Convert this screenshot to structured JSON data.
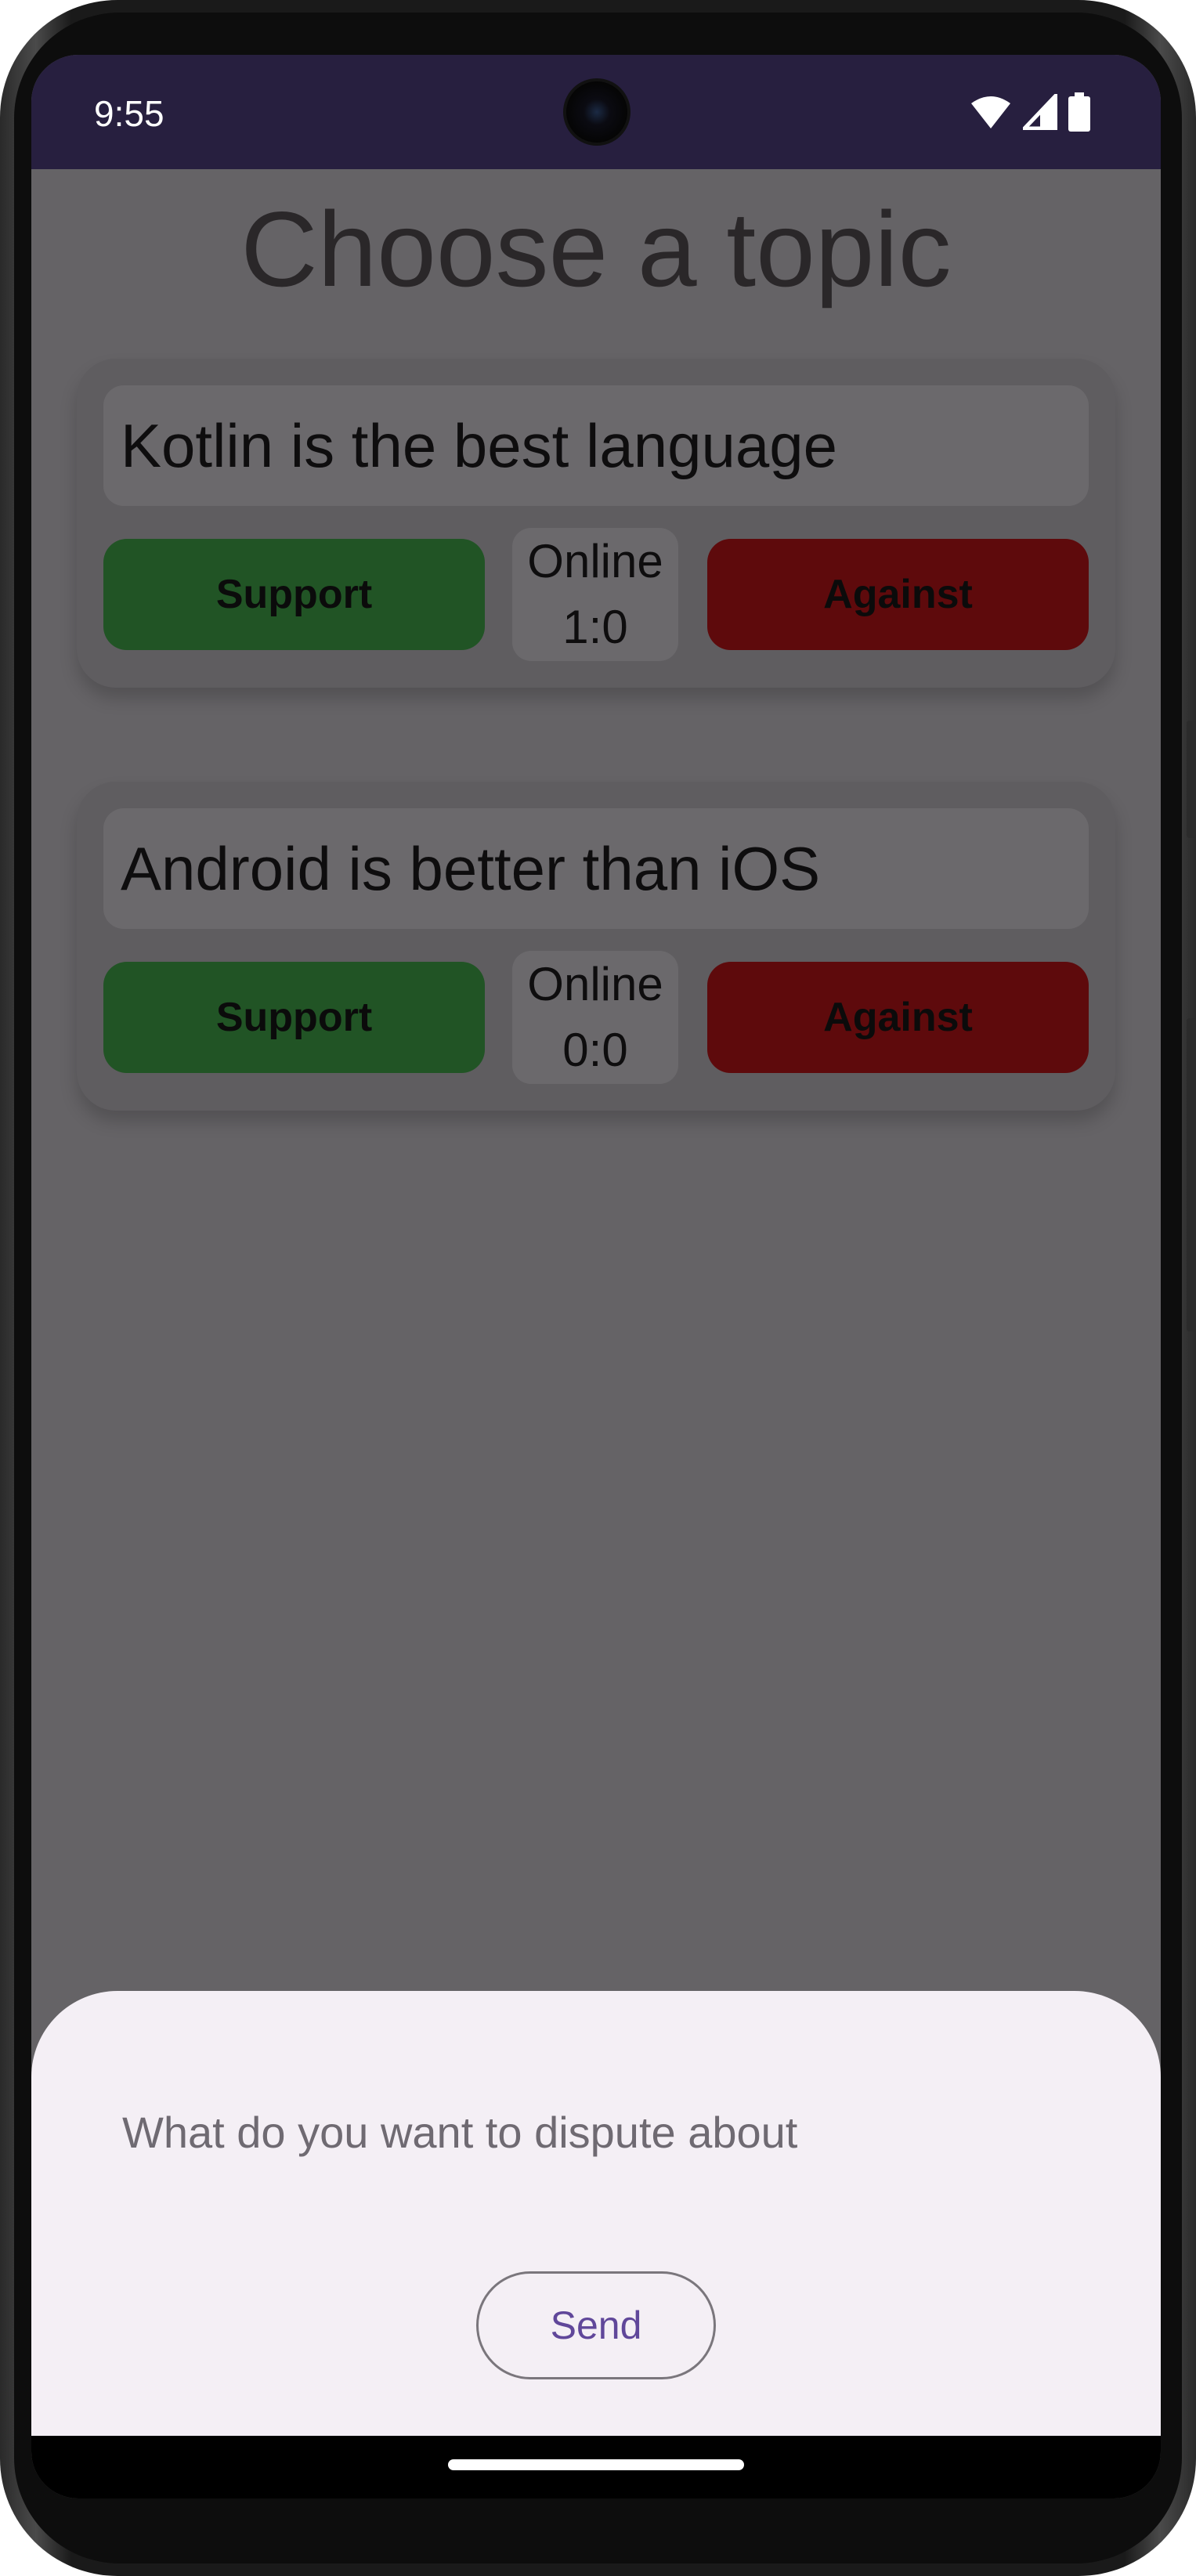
{
  "status_bar": {
    "time": "9:55",
    "icons": [
      "wifi-icon",
      "signal-icon",
      "battery-icon"
    ]
  },
  "page": {
    "title": "Choose a topic"
  },
  "topics": [
    {
      "title": "Kotlin is the best language",
      "support_label": "Support",
      "online_label": "Online",
      "score": "1:0",
      "against_label": "Against"
    },
    {
      "title": "Android is better than iOS",
      "support_label": "Support",
      "online_label": "Online",
      "score": "0:0",
      "against_label": "Against"
    }
  ],
  "sheet": {
    "input_value": "",
    "input_placeholder": "What do you want to dispute about",
    "send_label": "Send"
  },
  "colors": {
    "status_bar": "#271f3f",
    "scrim_background": "#656366",
    "support": "#215425",
    "against": "#5e0a0c",
    "sheet_background": "#f4eff5",
    "send_text": "#60479a"
  }
}
